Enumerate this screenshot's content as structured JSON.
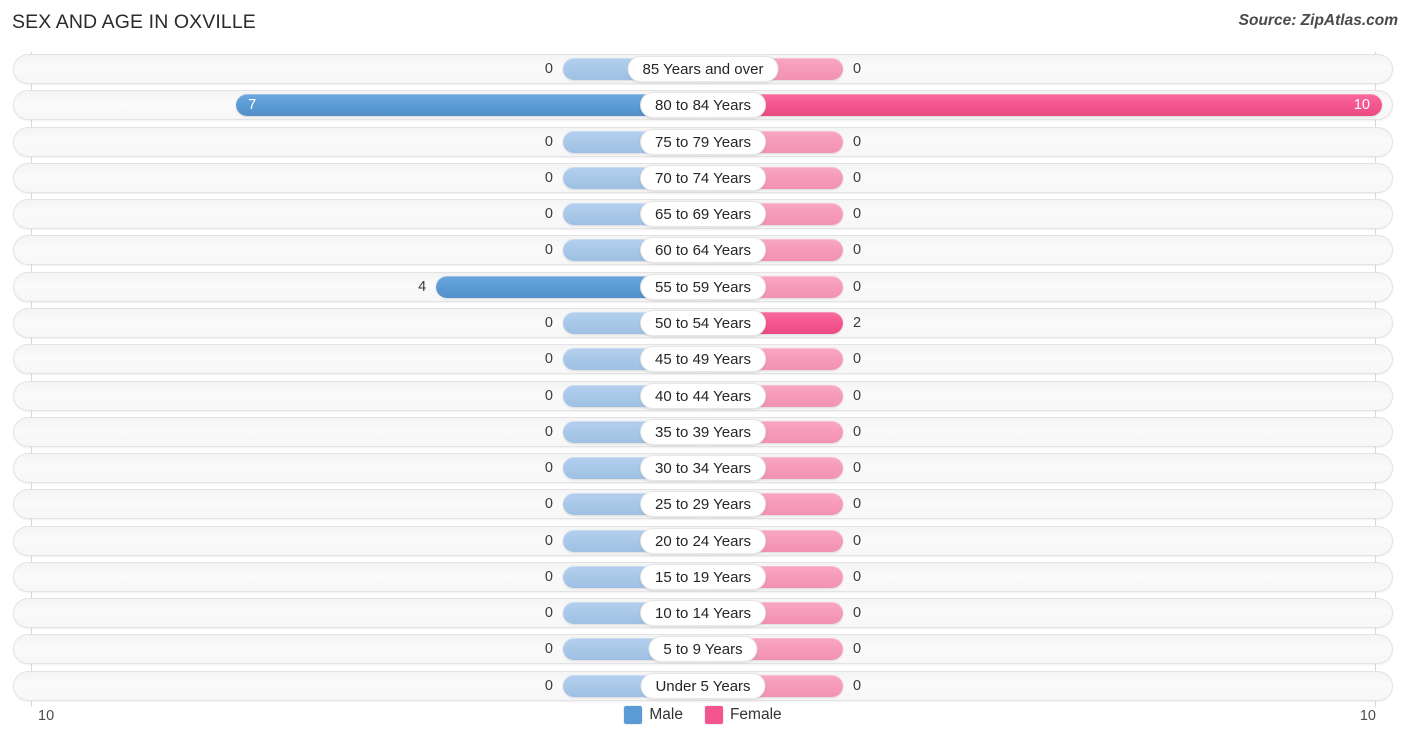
{
  "header": {
    "title": "SEX AND AGE IN OXVILLE",
    "source": "Source: ZipAtlas.com"
  },
  "legend": {
    "male_label": "Male",
    "female_label": "Female",
    "male_color": "#5b9bd5",
    "female_color": "#f4558e"
  },
  "axis": {
    "left_end": "10",
    "right_end": "10",
    "max": 10
  },
  "chart_data": {
    "type": "bar",
    "subtype": "population-pyramid",
    "title": "SEX AND AGE IN OXVILLE",
    "xlabel": "",
    "ylabel": "",
    "grid": false,
    "legend_position": "bottom-center",
    "xlim": [
      10,
      10
    ],
    "axis_left_max": 10,
    "axis_right_max": 10,
    "categories": [
      "85 Years and over",
      "80 to 84 Years",
      "75 to 79 Years",
      "70 to 74 Years",
      "65 to 69 Years",
      "60 to 64 Years",
      "55 to 59 Years",
      "50 to 54 Years",
      "45 to 49 Years",
      "40 to 44 Years",
      "35 to 39 Years",
      "30 to 34 Years",
      "25 to 29 Years",
      "20 to 24 Years",
      "15 to 19 Years",
      "10 to 14 Years",
      "5 to 9 Years",
      "Under 5 Years"
    ],
    "series": [
      {
        "name": "Male",
        "color": "#5b9bd5",
        "direction": "left",
        "values": [
          0,
          7,
          0,
          0,
          0,
          0,
          4,
          0,
          0,
          0,
          0,
          0,
          0,
          0,
          0,
          0,
          0,
          0
        ]
      },
      {
        "name": "Female",
        "color": "#f4558e",
        "direction": "right",
        "values": [
          0,
          10,
          0,
          0,
          0,
          0,
          0,
          2,
          0,
          0,
          0,
          0,
          0,
          0,
          0,
          0,
          0,
          0
        ]
      }
    ],
    "male_labels": [
      "0",
      "7",
      "0",
      "0",
      "0",
      "0",
      "4",
      "0",
      "0",
      "0",
      "0",
      "0",
      "0",
      "0",
      "0",
      "0",
      "0",
      "0"
    ],
    "female_labels": [
      "0",
      "10",
      "0",
      "0",
      "0",
      "0",
      "0",
      "2",
      "0",
      "0",
      "0",
      "0",
      "0",
      "0",
      "0",
      "0",
      "0",
      "0"
    ]
  }
}
